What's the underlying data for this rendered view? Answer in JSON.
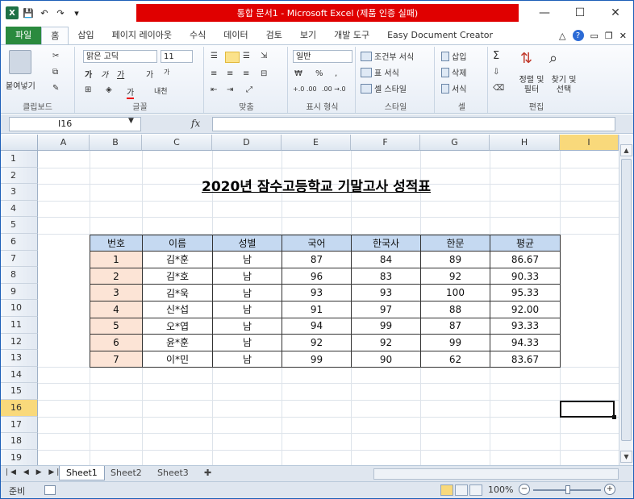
{
  "window": {
    "title": "통합 문서1 - Microsoft Excel (제품 인증 실패)",
    "controls": {
      "minimize": "—",
      "maximize": "☐",
      "close": "✕"
    }
  },
  "qat": {
    "save": "💾",
    "undo": "↶",
    "redo": "↷",
    "dropdown": "▾"
  },
  "tabs": [
    "파일",
    "홈",
    "삽입",
    "페이지 레이아웃",
    "수식",
    "데이터",
    "검토",
    "보기",
    "개발 도구",
    "Easy Document Creator"
  ],
  "ribbon": {
    "clipboard": {
      "paste": "붙여넣기",
      "label": "클립보드"
    },
    "font": {
      "name": "맑은 고딕",
      "size": "11",
      "bold": "가",
      "italic": "가",
      "underline": "가",
      "grow": "가",
      "shrink": "가",
      "color": "가",
      "phonetic": "내천",
      "label": "글꼴"
    },
    "alignment": {
      "label": "맞춤"
    },
    "number": {
      "format": "일반",
      "percent": "%",
      "comma": ",",
      "inc": "+.0 .00",
      "dec": ".00 →.0",
      "label": "표시 형식"
    },
    "styles": {
      "conditional": "조건부 서식",
      "table": "표 서식",
      "cell": "셀 스타일",
      "label": "스타일"
    },
    "cells": {
      "insert": "삽입",
      "delete": "삭제",
      "format": "서식",
      "label": "셀"
    },
    "editing": {
      "sort": "정렬 및 필터",
      "find": "찾기 및 선택",
      "sigma": "Σ",
      "label": "편집"
    }
  },
  "formula_bar": {
    "name_box": "I16",
    "fx": "fx",
    "value": ""
  },
  "columns": [
    "A",
    "B",
    "C",
    "D",
    "E",
    "F",
    "G",
    "H",
    "I"
  ],
  "rows": [
    "1",
    "2",
    "3",
    "4",
    "5",
    "6",
    "7",
    "8",
    "9",
    "10",
    "11",
    "12",
    "13",
    "14",
    "15",
    "16",
    "17",
    "18",
    "19"
  ],
  "sheet_title": "2020년 잠수고등학교 기말고사 성적표",
  "table": {
    "headers": [
      "번호",
      "이름",
      "성별",
      "국어",
      "한국사",
      "한문",
      "평균"
    ],
    "rows": [
      [
        "1",
        "김*훈",
        "남",
        "87",
        "84",
        "89",
        "86.67"
      ],
      [
        "2",
        "김*호",
        "남",
        "96",
        "83",
        "92",
        "90.33"
      ],
      [
        "3",
        "김*욱",
        "남",
        "93",
        "93",
        "100",
        "95.33"
      ],
      [
        "4",
        "신*섭",
        "남",
        "91",
        "97",
        "88",
        "92.00"
      ],
      [
        "5",
        "오*엽",
        "남",
        "94",
        "99",
        "87",
        "93.33"
      ],
      [
        "6",
        "윤*훈",
        "남",
        "92",
        "92",
        "99",
        "94.33"
      ],
      [
        "7",
        "이*민",
        "남",
        "99",
        "90",
        "62",
        "83.67"
      ]
    ]
  },
  "sheets": [
    "Sheet1",
    "Sheet2",
    "Sheet3"
  ],
  "status": {
    "ready": "준비",
    "zoom": "100%",
    "minus": "−",
    "plus": "+"
  }
}
